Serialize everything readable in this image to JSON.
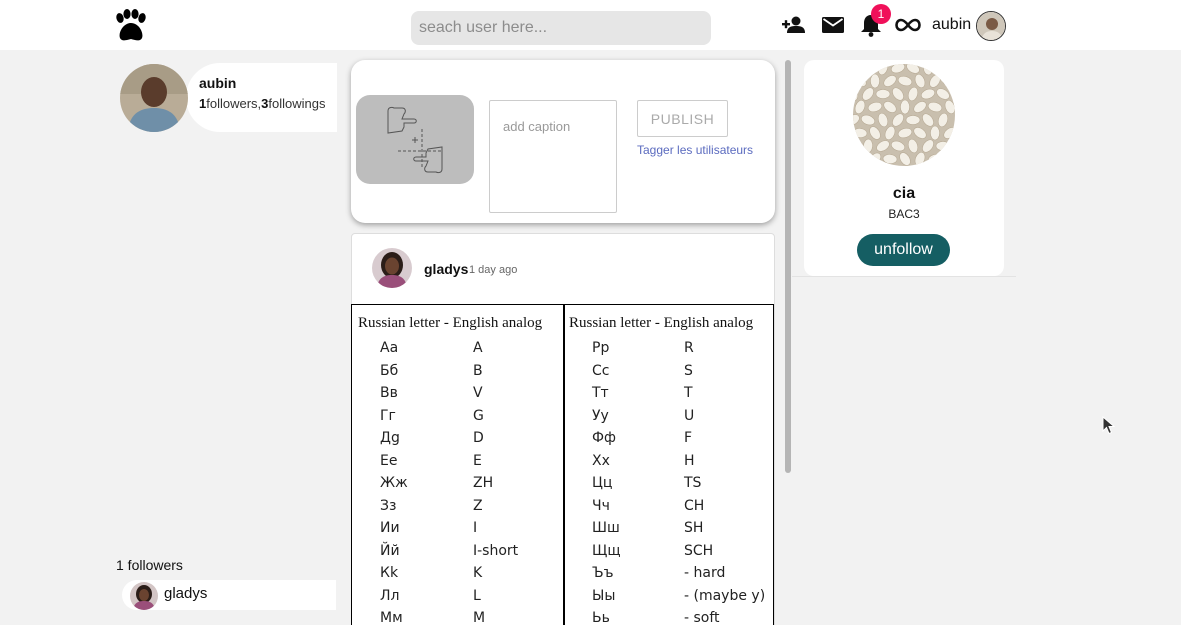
{
  "topbar": {
    "search_placeholder": "seach user here...",
    "notification_count": "1",
    "username": "aubin",
    "icons": [
      "paw-icon",
      "add-friend-icon",
      "mail-icon",
      "bell-icon",
      "infinity-icon"
    ]
  },
  "profile": {
    "name": "aubin",
    "followers_count": "1",
    "followers_label": "followers,",
    "followings_count": "3",
    "followings_label": "followings"
  },
  "followers": {
    "title": "1 followers",
    "items": [
      {
        "name": "gladys"
      }
    ]
  },
  "composer": {
    "caption_placeholder": "add caption",
    "publish_label": "PUBLISH",
    "tag_label": "Tagger les utilisateurs"
  },
  "post": {
    "author": "gladys",
    "time": "1 day ago",
    "image": {
      "left_header": "Russian letter - English analog",
      "right_header": "Russian letter - English analog",
      "left_rows": [
        [
          "Аа",
          "A"
        ],
        [
          "Бб",
          "B"
        ],
        [
          "Вв",
          "V"
        ],
        [
          "Гг",
          "G"
        ],
        [
          "Дg",
          "D"
        ],
        [
          "Ее",
          "E"
        ],
        [
          "Жж",
          "ZH"
        ],
        [
          "Зз",
          "Z"
        ],
        [
          "Ии",
          "I"
        ],
        [
          "Йй",
          "I-short"
        ],
        [
          "Кk",
          "K"
        ],
        [
          "Лл",
          "L"
        ],
        [
          "Мм",
          "M"
        ]
      ],
      "right_rows": [
        [
          "Рр",
          "R"
        ],
        [
          "Сс",
          "S"
        ],
        [
          "Тт",
          "T"
        ],
        [
          "Уу",
          "U"
        ],
        [
          "Фф",
          "F"
        ],
        [
          "Хх",
          "H"
        ],
        [
          "Цц",
          "TS"
        ],
        [
          "Чч",
          "CH"
        ],
        [
          "Шш",
          "SH"
        ],
        [
          "Щщ",
          "SCH"
        ],
        [
          "Ъъ",
          "- hard"
        ],
        [
          "Ыы",
          "- (maybe y)"
        ],
        [
          "Ьь",
          "- soft"
        ]
      ]
    }
  },
  "suggestion": {
    "name": "cia",
    "subtitle": "BAC3",
    "button_label": "unfollow"
  },
  "colors": {
    "accent": "#155e63",
    "badge": "#f0105a",
    "link": "#5b6bbf"
  }
}
